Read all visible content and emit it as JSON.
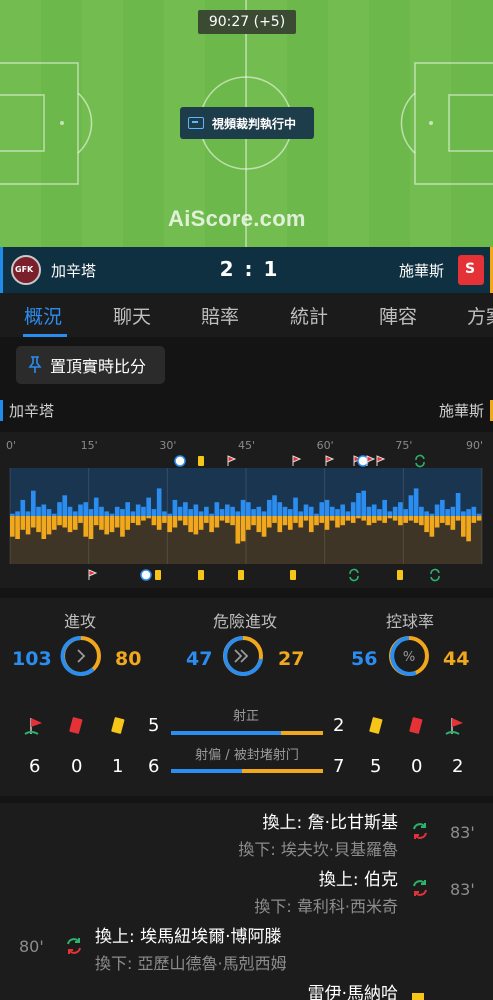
{
  "match": {
    "clock": "90:27 (+5)",
    "var_text": "視頻裁判執行中",
    "watermark": "AiScore.com",
    "home": "加辛塔",
    "away": "施華斯",
    "score": "2 : 1",
    "colors": {
      "home": "#2b8df0",
      "away": "#f2a81d",
      "pitch": "#6db84a"
    }
  },
  "tabs": [
    "概況",
    "聊天",
    "賠率",
    "統計",
    "陣容",
    "方案"
  ],
  "active_tab": "概況",
  "pin_label": "置頂實時比分",
  "team_labels": {
    "home": "加辛塔",
    "away": "施華斯"
  },
  "momentum": {
    "ticks": [
      "0'",
      "15'",
      "30'",
      "45'",
      "60'",
      "75'",
      "90'"
    ],
    "home_events": [
      "ball-icon",
      "yellow-card-icon",
      "corner-icon",
      "corner-icon",
      "corner-icon",
      "corner-icon",
      "ball-icon",
      "corner-icon",
      "corner-icon",
      "sub-icon"
    ],
    "away_events": [
      "corner-icon",
      "ball-icon",
      "yellow-card-icon",
      "yellow-card-icon",
      "yellow-card-icon",
      "yellow-card-icon",
      "sub-icon",
      "yellow-card-icon",
      "sub-icon"
    ],
    "home_values": [
      0.05,
      0.1,
      0.35,
      0.1,
      0.55,
      0.2,
      0.25,
      0.15,
      0.05,
      0.3,
      0.45,
      0.2,
      0.1,
      0.25,
      0.3,
      0.15,
      0.4,
      0.2,
      0.1,
      0.05,
      0.2,
      0.15,
      0.3,
      0.1,
      0.25,
      0.2,
      0.4,
      0.15,
      0.6,
      0.1,
      0.05,
      0.35,
      0.2,
      0.3,
      0.15,
      0.25,
      0.1,
      0.2,
      0.05,
      0.3,
      0.15,
      0.25,
      0.2,
      0.1,
      0.35,
      0.3,
      0.15,
      0.2,
      0.1,
      0.35,
      0.45,
      0.3,
      0.2,
      0.15,
      0.4,
      0.1,
      0.25,
      0.2,
      0.05,
      0.3,
      0.35,
      0.2,
      0.15,
      0.25,
      0.1,
      0.3,
      0.5,
      0.55,
      0.2,
      0.25,
      0.15,
      0.35,
      0.1,
      0.2,
      0.3,
      0.15,
      0.45,
      0.6,
      0.2,
      0.1,
      0.05,
      0.25,
      0.35,
      0.15,
      0.2,
      0.5,
      0.1,
      0.15,
      0.2,
      0.05
    ],
    "away_values": [
      0.45,
      0.5,
      0.3,
      0.4,
      0.25,
      0.35,
      0.5,
      0.4,
      0.3,
      0.2,
      0.25,
      0.35,
      0.3,
      0.15,
      0.45,
      0.5,
      0.2,
      0.3,
      0.4,
      0.35,
      0.25,
      0.45,
      0.3,
      0.15,
      0.2,
      0.1,
      0.05,
      0.2,
      0.3,
      0.15,
      0.35,
      0.25,
      0.1,
      0.2,
      0.35,
      0.4,
      0.3,
      0.15,
      0.35,
      0.25,
      0.1,
      0.15,
      0.2,
      0.6,
      0.55,
      0.3,
      0.2,
      0.35,
      0.45,
      0.25,
      0.15,
      0.35,
      0.2,
      0.3,
      0.15,
      0.25,
      0.1,
      0.35,
      0.2,
      0.15,
      0.3,
      0.1,
      0.25,
      0.2,
      0.1,
      0.15,
      0.05,
      0.1,
      0.2,
      0.15,
      0.1,
      0.15,
      0.05,
      0.1,
      0.2,
      0.15,
      0.1,
      0.15,
      0.2,
      0.35,
      0.45,
      0.25,
      0.15,
      0.2,
      0.3,
      0.1,
      0.45,
      0.55,
      0.15,
      0.1
    ]
  },
  "stats": {
    "attack": {
      "label": "進攻",
      "home": "103",
      "away": "80"
    },
    "dangerous": {
      "label": "危險進攻",
      "home": "47",
      "away": "27"
    },
    "possession": {
      "label": "控球率",
      "home": "56",
      "away": "44",
      "icon": "%"
    },
    "shots_on": {
      "label": "射正",
      "home": "5",
      "away": "2"
    },
    "shots_off": {
      "label": "射偏 / 被封堵射门",
      "home": "6",
      "away": "7"
    },
    "home_cards": {
      "corners": "6",
      "red": "0",
      "yellow": "1"
    },
    "away_cards": {
      "yellow": "5",
      "red": "0",
      "corners": "2"
    }
  },
  "events": [
    {
      "side": "away",
      "in": "換上: 詹·比甘斯基",
      "out": "換下: 埃夫坎·貝基羅魯",
      "minute": "83'"
    },
    {
      "side": "away",
      "in": "換上: 伯克",
      "out": "換下: 韋利科·西米奇",
      "minute": "83'"
    },
    {
      "side": "home",
      "in": "換上: 埃馬紐埃爾·博阿滕",
      "out": "換下: 亞歷山德魯·馬剋西姆",
      "minute": "80'"
    },
    {
      "side": "away",
      "in": "雷伊·馬納哈",
      "out": "",
      "minute": ""
    }
  ]
}
